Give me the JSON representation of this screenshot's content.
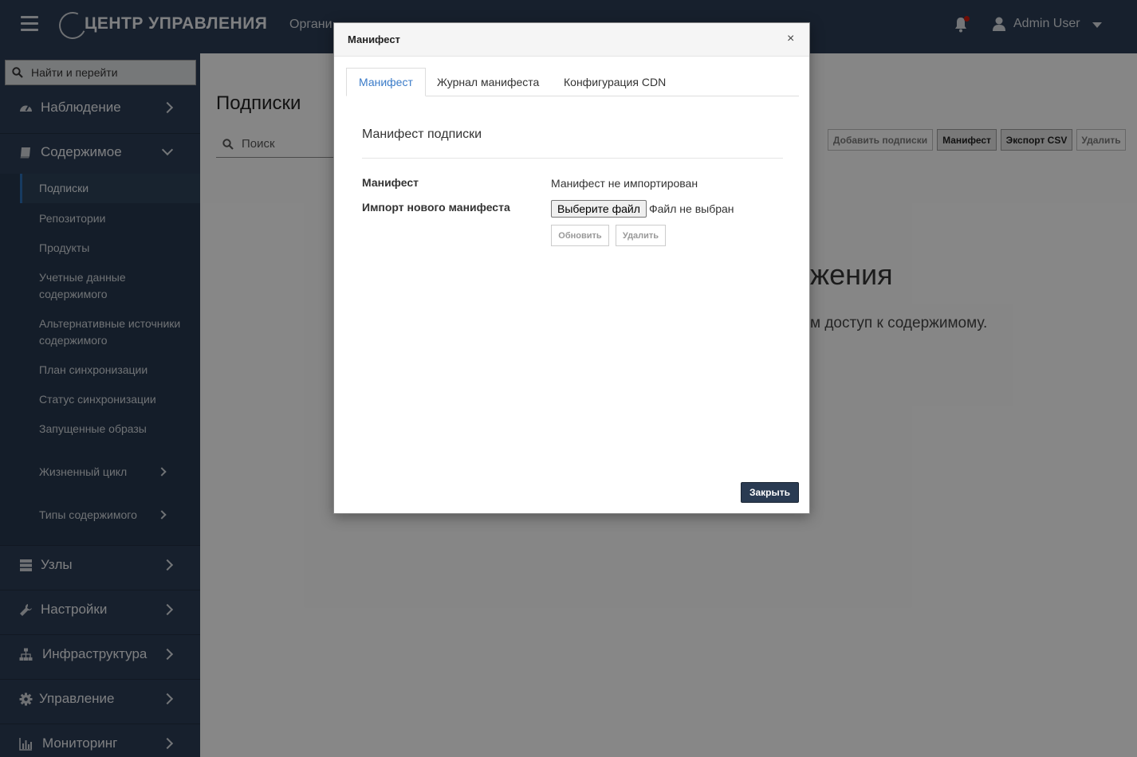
{
  "header": {
    "logo_text": "ЦЕНТР УПРАВЛЕНИЯ",
    "org_text": "Органи",
    "user_name": "Admin User"
  },
  "sidebar": {
    "search_placeholder": "Найти и перейти",
    "top_items": [
      {
        "label": "Наблюдение",
        "icon": "dashboard-icon"
      },
      {
        "label": "Содержимое",
        "icon": "book-icon",
        "expanded": true
      }
    ],
    "content_subitems": [
      {
        "label": "Подписки",
        "active": true
      },
      {
        "label": "Репозитории"
      },
      {
        "label": "Продукты"
      },
      {
        "label": "Учетные данные содержимого"
      },
      {
        "label": "Альтернативные источники содержимого"
      },
      {
        "label": "План синхронизации"
      },
      {
        "label": "Статус синхронизации"
      },
      {
        "label": "Запущенные образы"
      },
      {
        "label": "Жизненный цикл",
        "has_children": true
      },
      {
        "label": "Типы содержимого",
        "has_children": true
      }
    ],
    "bottom_items": [
      {
        "label": "Узлы",
        "icon": "server-icon"
      },
      {
        "label": "Настройки",
        "icon": "wrench-icon"
      },
      {
        "label": "Инфраструктура",
        "icon": "sitemap-icon"
      },
      {
        "label": "Управление",
        "icon": "gear-icon"
      },
      {
        "label": "Мониторинг",
        "icon": "bar-chart-icon"
      }
    ]
  },
  "main": {
    "title": "Подписки",
    "search_placeholder": "Поиск",
    "actions": [
      "Добавить подписки",
      "Манифест",
      "Экспорт CSV",
      "Удалить"
    ],
    "empty_title_fragment": "жения",
    "empty_text_fragment": "м доступ к содержимому."
  },
  "modal": {
    "title": "Манифест",
    "close_symbol": "×",
    "tabs": [
      "Манифест",
      "Журнал манифеста",
      "Конфигурация CDN"
    ],
    "active_tab": 0,
    "section_title": "Манифест подписки",
    "manifest_label": "Манифест",
    "manifest_value": "Манифест не импортирован",
    "import_label": "Импорт нового манифеста",
    "file_button": "Выберите файл",
    "file_status": "Файл не выбран",
    "refresh_button": "Обновить",
    "delete_button": "Удалить",
    "close_button": "Закрыть"
  },
  "colors": {
    "nav_bg": "#2a3b52",
    "accent": "#3a7bc8",
    "active_marker": "#2b6cb0",
    "notification_dot": "#c9190b"
  }
}
